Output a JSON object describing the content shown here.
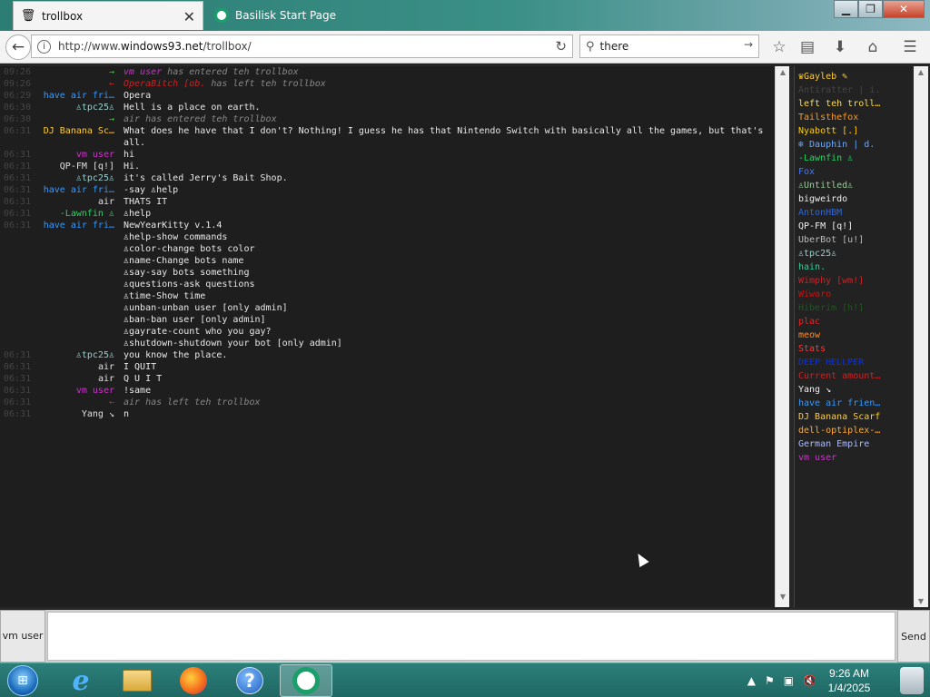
{
  "browser": {
    "tabs": [
      {
        "label": "trollbox",
        "active": true
      },
      {
        "label": "Basilisk Start Page",
        "active": false
      }
    ],
    "url_prefix": "http://www.",
    "url_host": "windows93.net",
    "url_path": "/trollbox/",
    "search_value": "there",
    "icons": {
      "back": "back-arrow-icon",
      "info": "info-icon",
      "reload": "reload-icon",
      "search": "search-icon",
      "go": "go-arrow-icon",
      "bookmark": "star-icon",
      "reader": "reader-icon",
      "download": "download-icon",
      "home": "home-icon",
      "menu": "hamburger-menu-icon"
    }
  },
  "chat": {
    "lines": [
      {
        "time": "09:26",
        "kind": "sys",
        "arrow": "→",
        "arrow_color": "#33cc33",
        "who": "vm user",
        "who_color": "#cc33cc",
        "text": "has entered teh trollbox"
      },
      {
        "time": "09:26",
        "kind": "sys",
        "arrow": "←",
        "arrow_color": "#cc2222",
        "who": "OperaBitch [ob.",
        "who_color": "#cc2222",
        "text": "has left teh trollbox"
      },
      {
        "time": "06:29",
        "kind": "msg",
        "nick": "have air fri…",
        "nick_color": "#3399ff",
        "text": "Opera"
      },
      {
        "time": "06:30",
        "kind": "msg",
        "nick": "♙tpc25♙",
        "nick_color": "#9cc",
        "text": "Hell is a place on earth."
      },
      {
        "time": "06:30",
        "kind": "sys",
        "arrow": "→",
        "arrow_color": "#33cc33",
        "who": "air",
        "who_color": "#888888",
        "text": "has entered teh trollbox"
      },
      {
        "time": "06:31",
        "kind": "msg",
        "nick": "DJ Banana Sc…",
        "nick_color": "#ffcc33",
        "text": "What does he have that I don't? Nothing! I guess he has that Nintendo Switch with basically all the games, but that's all.",
        "wrap": true
      },
      {
        "time": "06:31",
        "kind": "msg",
        "nick": "vm user",
        "nick_color": "#cc33cc",
        "text": "hi"
      },
      {
        "time": "06:31",
        "kind": "msg",
        "nick": "QP-FM [q!]",
        "nick_color": "#e0e0e0",
        "text": "Hi."
      },
      {
        "time": "06:31",
        "kind": "msg",
        "nick": "♙tpc25♙",
        "nick_color": "#9cc",
        "text": "it's called Jerry's Bait Shop."
      },
      {
        "time": "06:31",
        "kind": "msg",
        "nick": "have air fri…",
        "nick_color": "#3399ff",
        "text": "-say ♙help"
      },
      {
        "time": "06:31",
        "kind": "msg",
        "nick": "air",
        "nick_color": "#e0e0e0",
        "text": "THATS IT"
      },
      {
        "time": "06:31",
        "kind": "msg",
        "nick": "-Lawnfin ♙",
        "nick_color": "#33cc66",
        "text": "♙help"
      },
      {
        "time": "06:31",
        "kind": "msg",
        "nick": "have air fri…",
        "nick_color": "#3399ff",
        "text": "NewYearKitty v.1.4"
      },
      {
        "time": "",
        "kind": "msg",
        "nick": "",
        "nick_color": "#fff",
        "text": "♙help-show commands"
      },
      {
        "time": "",
        "kind": "msg",
        "nick": "",
        "nick_color": "#fff",
        "text": "♙color-change bots color"
      },
      {
        "time": "",
        "kind": "msg",
        "nick": "",
        "nick_color": "#fff",
        "text": "♙name-Change bots name"
      },
      {
        "time": "",
        "kind": "msg",
        "nick": "",
        "nick_color": "#fff",
        "text": "♙say-say bots something"
      },
      {
        "time": "",
        "kind": "msg",
        "nick": "",
        "nick_color": "#fff",
        "text": "♙questions-ask questions"
      },
      {
        "time": "",
        "kind": "msg",
        "nick": "",
        "nick_color": "#fff",
        "text": "♙time-Show time"
      },
      {
        "time": "",
        "kind": "msg",
        "nick": "",
        "nick_color": "#fff",
        "text": "♙unban-unban user [only admin]"
      },
      {
        "time": "",
        "kind": "msg",
        "nick": "",
        "nick_color": "#fff",
        "text": "♙ban-ban user [only admin]"
      },
      {
        "time": "",
        "kind": "msg",
        "nick": "",
        "nick_color": "#fff",
        "text": "♙gayrate-count who you gay?"
      },
      {
        "time": "",
        "kind": "msg",
        "nick": "",
        "nick_color": "#fff",
        "text": "♙shutdown-shutdown your bot [only admin]"
      },
      {
        "time": "06:31",
        "kind": "msg",
        "nick": "♙tpc25♙",
        "nick_color": "#9cc",
        "text": "you know the place."
      },
      {
        "time": "06:31",
        "kind": "msg",
        "nick": "air",
        "nick_color": "#e0e0e0",
        "text": "I QUIT"
      },
      {
        "time": "06:31",
        "kind": "msg",
        "nick": "air",
        "nick_color": "#e0e0e0",
        "text": "Q U I T"
      },
      {
        "time": "06:31",
        "kind": "msg",
        "nick": "vm user",
        "nick_color": "#cc33cc",
        "text": "!same"
      },
      {
        "time": "06:31",
        "kind": "sys",
        "arrow": "←",
        "arrow_color": "#cc2222",
        "who": "air",
        "who_color": "#888888",
        "text": "has left teh trollbox"
      },
      {
        "time": "06:31",
        "kind": "msg",
        "nick": "Yang ↘",
        "nick_color": "#e0e0e0",
        "text": "n"
      }
    ]
  },
  "userlist": [
    {
      "name": "♛Gayleb ✎",
      "color": "#ffcc33"
    },
    {
      "name": "Antiratter | i.",
      "color": "#444444"
    },
    {
      "name": "left teh troll…",
      "color": "#ffdd44"
    },
    {
      "name": "Tailsthefox",
      "color": "#ff9922"
    },
    {
      "name": "Nyabott [.]",
      "color": "#ffcc00"
    },
    {
      "name": "❄ Dauphin | d.",
      "color": "#66aaff"
    },
    {
      "name": "-Lawnfin ♙",
      "color": "#33cc66"
    },
    {
      "name": "Fox",
      "color": "#4477ff"
    },
    {
      "name": "♙Untitled♙",
      "color": "#99cc99"
    },
    {
      "name": "bigweirdo",
      "color": "#eeeeee"
    },
    {
      "name": "AntonHBM",
      "color": "#3366cc"
    },
    {
      "name": "QP-FM [q!]",
      "color": "#eeeeee"
    },
    {
      "name": "UberBot [u!]",
      "color": "#bbbbbb"
    },
    {
      "name": "♙tpc25♙",
      "color": "#99cccc"
    },
    {
      "name": "hain.",
      "color": "#33cc99"
    },
    {
      "name": "Wimphy [wm!]",
      "color": "#cc2222"
    },
    {
      "name": "Wiwaro",
      "color": "#cc1111"
    },
    {
      "name": "Hiberim [h!]",
      "color": "#225522"
    },
    {
      "name": "plac",
      "color": "#ee2222"
    },
    {
      "name": "meow",
      "color": "#ff8822"
    },
    {
      "name": "Stats",
      "color": "#ff3333"
    },
    {
      "name": "DEEP HELLPER",
      "color": "#1133cc"
    },
    {
      "name": "Current amount…",
      "color": "#cc2222"
    },
    {
      "name": "Yang ↘",
      "color": "#eeeeee"
    },
    {
      "name": "have air frien…",
      "color": "#3399ff"
    },
    {
      "name": "DJ Banana Scarf",
      "color": "#ffcc33"
    },
    {
      "name": "dell-optiplex-…",
      "color": "#ffaa33"
    },
    {
      "name": "German Empire",
      "color": "#aabbff"
    },
    {
      "name": "vm user",
      "color": "#cc33cc"
    }
  ],
  "input": {
    "nick_label": "vm user",
    "send_label": "Send",
    "value": ""
  },
  "taskbar": {
    "apps": [
      {
        "name": "internet-explorer-icon"
      },
      {
        "name": "folder-icon"
      },
      {
        "name": "firefox-icon"
      },
      {
        "name": "help-icon"
      },
      {
        "name": "basilisk-icon"
      }
    ],
    "clock_time": "9:26 AM",
    "clock_date": "1/4/2025",
    "tray_icons": [
      "show-hidden-icons-icon",
      "flag-icon",
      "network-icon",
      "volume-muted-icon"
    ]
  },
  "window": {
    "controls": {
      "minimize": "minimize-icon",
      "maximize": "maximize-icon",
      "close": "close-icon"
    }
  }
}
